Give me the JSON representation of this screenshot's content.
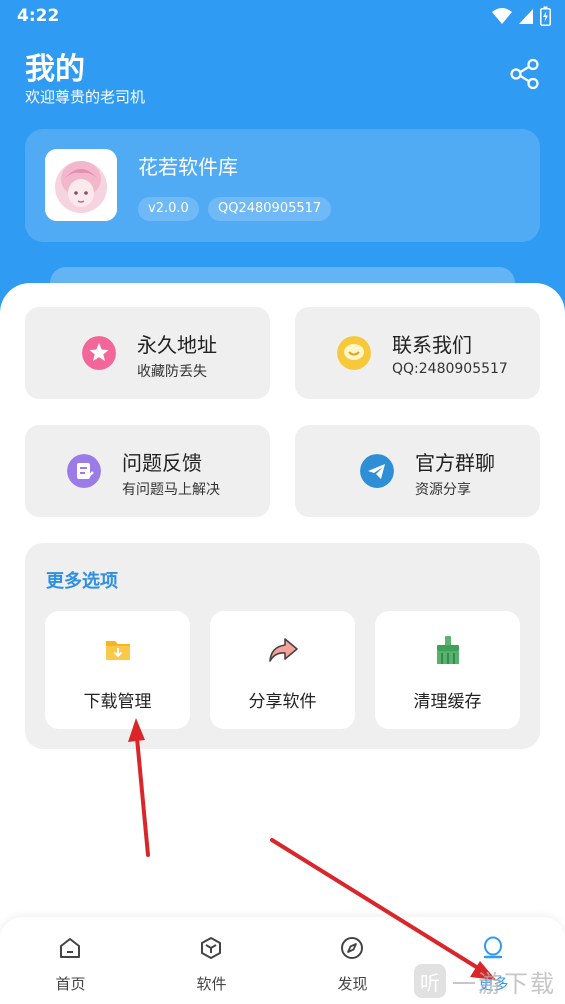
{
  "status_bar": {
    "time": "4:22"
  },
  "header": {
    "title": "我的",
    "subtitle": "欢迎尊贵的老司机"
  },
  "profile": {
    "name": "花若软件库",
    "version": "v2.0.0",
    "qq": "QQ2480905517"
  },
  "tiles": [
    {
      "title": "永久地址",
      "subtitle": "收藏防丢失",
      "icon": "star-icon",
      "color": "#F2669A"
    },
    {
      "title": "联系我们",
      "subtitle": "QQ:2480905517",
      "icon": "chat-bubble-icon",
      "color": "#F7C83A"
    },
    {
      "title": "问题反馈",
      "subtitle": "有问题马上解决",
      "icon": "feedback-icon",
      "color": "#9A7BE8"
    },
    {
      "title": "官方群聊",
      "subtitle": "资源分享",
      "icon": "telegram-icon",
      "color": "#2E8FD6"
    }
  ],
  "more": {
    "title": "更多选项",
    "options": [
      {
        "label": "下载管理",
        "icon": "download-folder-icon",
        "color": "#F8B51C"
      },
      {
        "label": "分享软件",
        "icon": "share-arrow-icon",
        "color": "#F2857A"
      },
      {
        "label": "清理缓存",
        "icon": "broom-icon",
        "color": "#3FA05A"
      }
    ]
  },
  "nav": [
    {
      "label": "首页",
      "icon": "home-icon"
    },
    {
      "label": "软件",
      "icon": "box-icon"
    },
    {
      "label": "发现",
      "icon": "compass-icon"
    },
    {
      "label": "更多",
      "icon": "user-icon",
      "active": true
    }
  ],
  "watermark": {
    "text": "一游下载"
  },
  "colors": {
    "primary": "#2F9BF2",
    "tile_bg": "#EFEFEF",
    "arrow": "#D8262A"
  }
}
